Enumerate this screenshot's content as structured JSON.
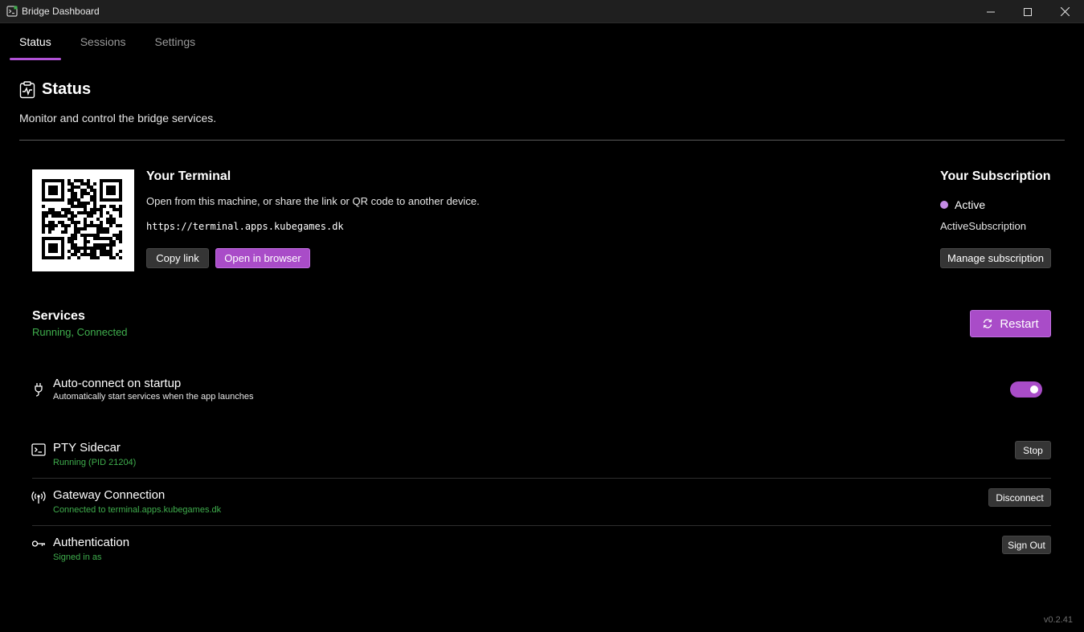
{
  "window": {
    "title": "Bridge Dashboard"
  },
  "tabs": [
    {
      "label": "Status",
      "active": true
    },
    {
      "label": "Sessions",
      "active": false
    },
    {
      "label": "Settings",
      "active": false
    }
  ],
  "page": {
    "title": "Status",
    "subtitle": "Monitor and control the bridge services."
  },
  "terminal": {
    "title": "Your Terminal",
    "description": "Open from this machine, or share the link or QR code to another device.",
    "url": "https://terminal.apps.kubegames.dk",
    "copy_label": "Copy link",
    "open_label": "Open in browser"
  },
  "subscription": {
    "title": "Your Subscription",
    "status": "Active",
    "name": "ActiveSubscription",
    "manage_label": "Manage subscription"
  },
  "services": {
    "title": "Services",
    "status": "Running, Connected",
    "restart_label": "Restart",
    "autoconnect": {
      "title": "Auto-connect on startup",
      "description": "Automatically start services when the app launches",
      "enabled": true
    },
    "items": [
      {
        "title": "PTY Sidecar",
        "status": "Running (PID 21204)",
        "action": "Stop",
        "icon": "terminal-icon"
      },
      {
        "title": "Gateway Connection",
        "status": "Connected to terminal.apps.kubegames.dk",
        "action": "Disconnect",
        "icon": "broadcast-icon"
      },
      {
        "title": "Authentication",
        "status": "Signed in as",
        "action": "Sign Out",
        "icon": "key-icon"
      }
    ]
  },
  "version": "v0.2.41",
  "colors": {
    "accent": "#a94cc8",
    "success": "#3fae4d",
    "background": "#000000",
    "titlebar": "#1f1f1f"
  }
}
